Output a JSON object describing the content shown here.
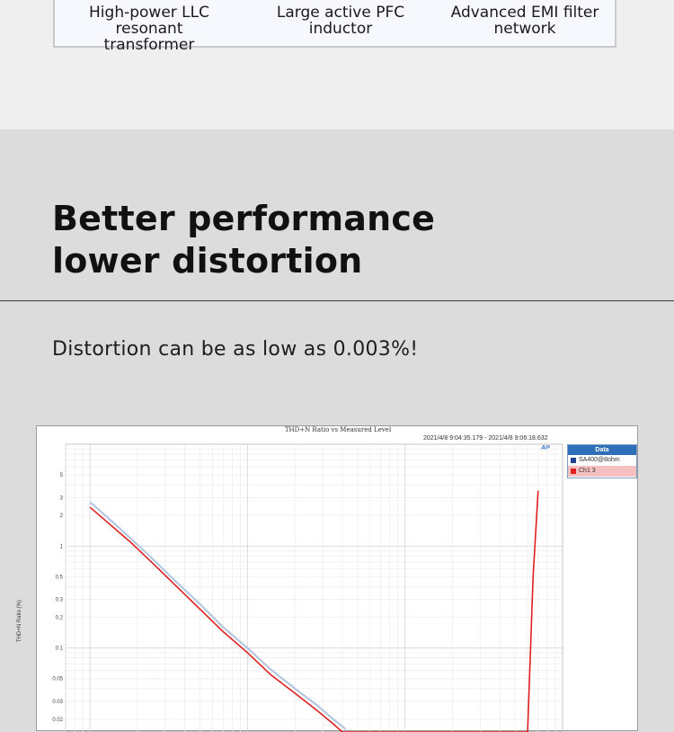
{
  "features": [
    {
      "line1": "High-power LLC resonant",
      "line2": "transformer"
    },
    {
      "line1": "Large active PFC",
      "line2": "inductor"
    },
    {
      "line1": "Advanced EMI filter",
      "line2": "network"
    }
  ],
  "headline": {
    "line1": "Better performance",
    "line2": "lower distortion"
  },
  "subline": "Distortion can be as low as 0.003%!",
  "chart": {
    "title": "THD+N Ratio vs Measured Level",
    "time_range": "2021/4/8 9:04:35.179 -   2021/4/8 9:06:18.632",
    "logo": "AP",
    "ylabel": "THD+N Ratio (%)",
    "legend_title": "Data",
    "legend_items": [
      "SA400@8ohm",
      "Ch1  3"
    ],
    "colors": {
      "series1": "#b0c4de",
      "series2": "#e02020",
      "legend_head": "#2f6fb7"
    }
  },
  "chart_data": {
    "type": "line",
    "title": "THD+N Ratio vs Measured Level",
    "ylabel": "THD+N Ratio (%)",
    "yscale": "log",
    "ylim": [
      0.015,
      10
    ],
    "yticks": [
      5,
      3,
      2,
      1,
      0.5,
      0.3,
      0.2,
      0.1,
      0.05,
      0.03,
      0.02
    ],
    "ytick_labels": [
      "5",
      "3",
      "2",
      "1",
      "0.5",
      "0.3",
      "0.2",
      "0.1",
      "0.05",
      "0.03",
      "0.02"
    ],
    "series": [
      {
        "name": "SA400@8ohm",
        "color": "#b0c4de",
        "points": [
          [
            0.1,
            2.7
          ],
          [
            0.13,
            1.9
          ],
          [
            0.18,
            1.2
          ],
          [
            0.25,
            0.75
          ],
          [
            0.35,
            0.45
          ],
          [
            0.5,
            0.27
          ],
          [
            0.7,
            0.16
          ],
          [
            1.0,
            0.1
          ],
          [
            1.4,
            0.062
          ],
          [
            2.0,
            0.04
          ],
          [
            2.8,
            0.027
          ],
          [
            3.5,
            0.02
          ],
          [
            4.2,
            0.016
          ]
        ]
      },
      {
        "name": "Ch1  3",
        "color": "#e02020",
        "points": [
          [
            0.1,
            2.4
          ],
          [
            0.13,
            1.7
          ],
          [
            0.18,
            1.1
          ],
          [
            0.25,
            0.68
          ],
          [
            0.35,
            0.41
          ],
          [
            0.5,
            0.24
          ],
          [
            0.7,
            0.145
          ],
          [
            1.0,
            0.09
          ],
          [
            1.4,
            0.055
          ],
          [
            2.0,
            0.036
          ],
          [
            2.8,
            0.024
          ],
          [
            3.5,
            0.018
          ],
          [
            4.0,
            0.015
          ],
          [
            60,
            0.015
          ],
          [
            65,
            0.5
          ],
          [
            70,
            3.5
          ]
        ]
      }
    ]
  }
}
